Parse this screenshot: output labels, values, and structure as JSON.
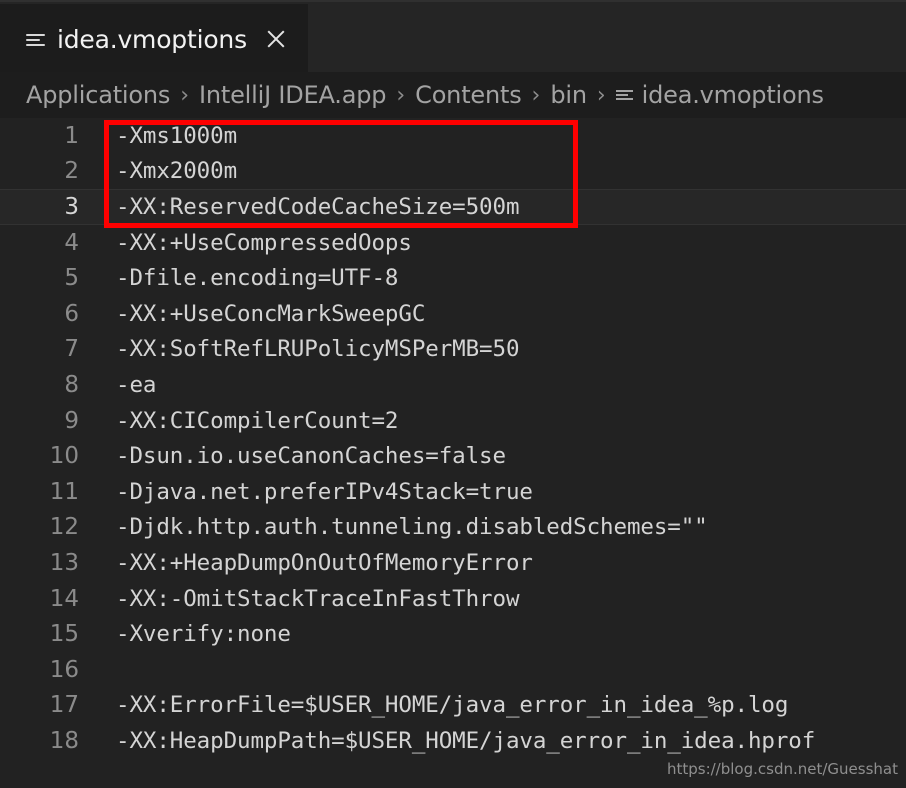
{
  "window": {
    "title": "idea.vmoptions"
  },
  "tab": {
    "icon": "text-file-lines-icon",
    "label": "idea.vmoptions",
    "close_label": "×"
  },
  "breadcrumb": {
    "separator": "›",
    "items": [
      {
        "label": "Applications"
      },
      {
        "label": "IntelliJ IDEA.app"
      },
      {
        "label": "Contents"
      },
      {
        "label": "bin"
      },
      {
        "label": "idea.vmoptions",
        "icon": "text-file-lines-icon"
      }
    ]
  },
  "editor": {
    "current_line": 3,
    "lines": [
      {
        "n": "1",
        "text": "-Xms1000m"
      },
      {
        "n": "2",
        "text": "-Xmx2000m"
      },
      {
        "n": "3",
        "text": "-XX:ReservedCodeCacheSize=500m"
      },
      {
        "n": "4",
        "text": "-XX:+UseCompressedOops"
      },
      {
        "n": "5",
        "text": "-Dfile.encoding=UTF-8"
      },
      {
        "n": "6",
        "text": "-XX:+UseConcMarkSweepGC"
      },
      {
        "n": "7",
        "text": "-XX:SoftRefLRUPolicyMSPerMB=50"
      },
      {
        "n": "8",
        "text": "-ea"
      },
      {
        "n": "9",
        "text": "-XX:CICompilerCount=2"
      },
      {
        "n": "10",
        "text": "-Dsun.io.useCanonCaches=false"
      },
      {
        "n": "11",
        "text": "-Djava.net.preferIPv4Stack=true"
      },
      {
        "n": "12",
        "text": "-Djdk.http.auth.tunneling.disabledSchemes=\"\""
      },
      {
        "n": "13",
        "text": "-XX:+HeapDumpOnOutOfMemoryError"
      },
      {
        "n": "14",
        "text": "-XX:-OmitStackTraceInFastThrow"
      },
      {
        "n": "15",
        "text": "-Xverify:none"
      },
      {
        "n": "16",
        "text": ""
      },
      {
        "n": "17",
        "text": "-XX:ErrorFile=$USER_HOME/java_error_in_idea_%p.log"
      },
      {
        "n": "18",
        "text": "-XX:HeapDumpPath=$USER_HOME/java_error_in_idea.hprof"
      }
    ]
  },
  "annotation": {
    "color": "#fe0000",
    "covers_lines": "1-3"
  },
  "watermark": {
    "text": "https://blog.csdn.net/Guesshat"
  },
  "colors": {
    "editor_background": "#222222",
    "tab_background": "#1c1c1c",
    "tabbar_background": "#252525",
    "breadcrumb_background": "#1d1d1d",
    "code_text": "#d4d4d4",
    "line_number": "#8b8b8b",
    "annotation": "#fe0000"
  }
}
